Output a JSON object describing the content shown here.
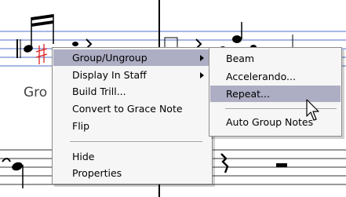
{
  "staff": {
    "label": "Gro"
  },
  "context_menu": {
    "items": [
      {
        "label": "Group/Ungroup",
        "has_submenu": true,
        "highlighted": true
      },
      {
        "label": "Display In Staff",
        "has_submenu": true,
        "highlighted": false
      },
      {
        "label": "Build Trill...",
        "has_submenu": false,
        "highlighted": false
      },
      {
        "label": "Convert to Grace Note",
        "has_submenu": false,
        "highlighted": false
      },
      {
        "label": "Flip",
        "has_submenu": false,
        "highlighted": false
      },
      {
        "label": "Hide",
        "has_submenu": false,
        "highlighted": false
      },
      {
        "label": "Properties",
        "has_submenu": false,
        "highlighted": false
      }
    ]
  },
  "submenu": {
    "items": [
      {
        "label": "Beam",
        "highlighted": false
      },
      {
        "label": "Accelerando...",
        "highlighted": false
      },
      {
        "label": "Repeat...",
        "highlighted": true
      },
      {
        "label": "Auto Group Notes",
        "highlighted": false
      }
    ]
  },
  "colors": {
    "staff_line": "#5070c8",
    "highlight": "#adadc4",
    "selected_note": "#e02020",
    "menu_background": "#f6f6f6"
  },
  "icons": {
    "cursor": "arrow-pointer-icon",
    "submenu_indicator": "chevron-right-icon"
  }
}
